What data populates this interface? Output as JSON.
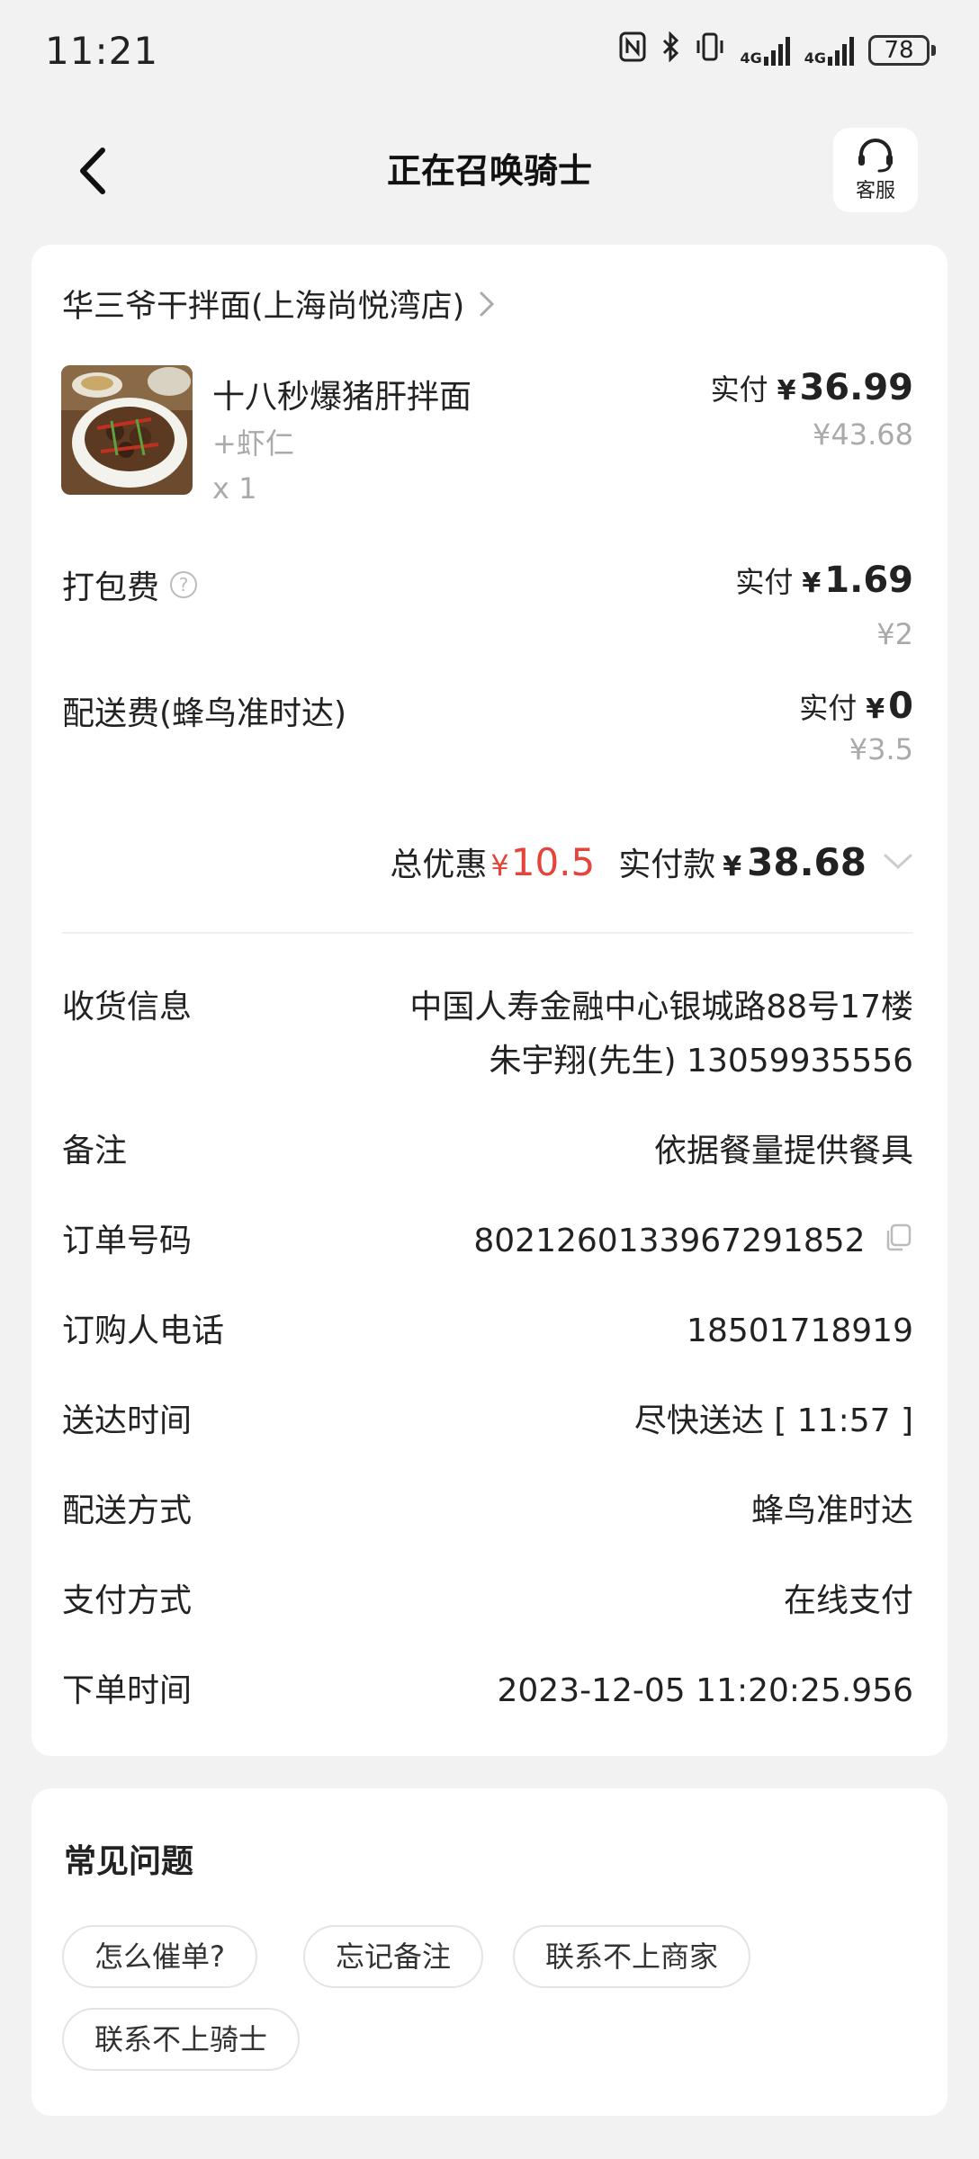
{
  "status_bar": {
    "time": "11:21",
    "net1": "4G",
    "net2": "4G",
    "battery": "78"
  },
  "header": {
    "title": "正在召唤骑士",
    "customer_service_label": "客服"
  },
  "order": {
    "shop_name": "华三爷干拌面(上海尚悦湾店)",
    "item": {
      "name": "十八秒爆猪肝拌面",
      "spec": "+虾仁",
      "qty": "x 1",
      "paid_label": "实付",
      "currency": "¥",
      "paid_amount": "36.99",
      "original_price": "¥43.68"
    },
    "packing_fee": {
      "label": "打包费",
      "help": "?",
      "paid_label": "实付",
      "currency": "¥",
      "paid_amount": "1.69",
      "original_price": "¥2"
    },
    "delivery_fee": {
      "label": "配送费(蜂鸟准时达)",
      "paid_label": "实付",
      "currency": "¥",
      "paid_amount": "0",
      "original_price": "¥3.5"
    },
    "totals": {
      "discount_label": "总优惠",
      "discount_currency": "¥",
      "discount_amount": "10.5",
      "paid_label": "实付款",
      "paid_currency": "¥",
      "paid_amount": "38.68"
    },
    "info": {
      "receiver_label": "收货信息",
      "receiver_address": "中国人寿金融中心银城路88号17楼",
      "receiver_contact": "朱宇翔(先生) 13059935556",
      "remark_label": "备注",
      "remark_value": "依据餐量提供餐具",
      "order_no_label": "订单号码",
      "order_no_value": "8021260133967291852",
      "buyer_phone_label": "订购人电话",
      "buyer_phone_value": "18501718919",
      "delivery_time_label": "送达时间",
      "delivery_time_value": "尽快送达 [ 11:57 ]",
      "delivery_method_label": "配送方式",
      "delivery_method_value": "蜂鸟准时达",
      "payment_label": "支付方式",
      "payment_value": "在线支付",
      "order_time_label": "下单时间",
      "order_time_value": "2023-12-05 11:20:25.956"
    }
  },
  "faq": {
    "title": "常见问题",
    "chips": [
      "怎么催单?",
      "忘记备注",
      "联系不上商家",
      "联系不上骑士"
    ]
  },
  "colors": {
    "accent_red": "#e5443a",
    "background": "#f2f2f2",
    "card": "#ffffff"
  }
}
